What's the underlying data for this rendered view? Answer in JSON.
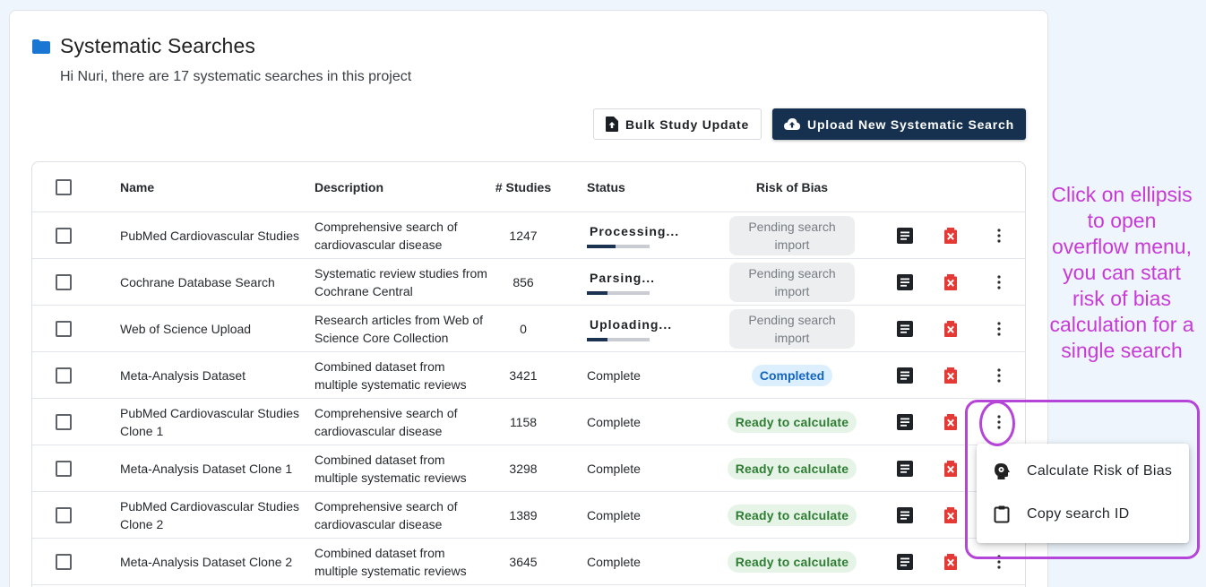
{
  "header": {
    "title": "Systematic Searches",
    "subtitle": "Hi Nuri, there are 17 systematic searches in this project",
    "icon": "folder-icon",
    "icon_color": "#1976d2"
  },
  "toolbar": {
    "bulk_update_label": "Bulk Study Update",
    "upload_label": "Upload New Systematic Search"
  },
  "table": {
    "columns": {
      "name": "Name",
      "description": "Description",
      "studies": "# Studies",
      "status": "Status",
      "risk_of_bias": "Risk of Bias"
    },
    "rows": [
      {
        "name": "PubMed Cardiovascular Studies",
        "description": "Comprehensive search of cardiovascular disease",
        "studies": "1247",
        "status": "Processing...",
        "status_type": "progress",
        "progress": 0.45,
        "rob": "Pending search import",
        "rob_type": "pending"
      },
      {
        "name": "Cochrane Database Search",
        "description": "Systematic review studies from Cochrane Central",
        "studies": "856",
        "status": "Parsing...",
        "status_type": "progress",
        "progress": 0.33,
        "rob": "Pending search import",
        "rob_type": "pending"
      },
      {
        "name": "Web of Science Upload",
        "description": "Research articles from Web of Science Core Collection",
        "studies": "0",
        "status": "Uploading...",
        "status_type": "progress",
        "progress": 0.33,
        "rob": "Pending search import",
        "rob_type": "pending"
      },
      {
        "name": "Meta-Analysis Dataset",
        "description": "Combined dataset from multiple systematic reviews",
        "studies": "3421",
        "status": "Complete",
        "status_type": "text",
        "rob": "Completed",
        "rob_type": "completed"
      },
      {
        "name": "PubMed Cardiovascular Studies Clone 1",
        "description": "Comprehensive search of cardiovascular disease",
        "studies": "1158",
        "status": "Complete",
        "status_type": "text",
        "rob": "Ready to calculate",
        "rob_type": "ready"
      },
      {
        "name": "Meta-Analysis Dataset Clone 1",
        "description": "Combined dataset from multiple systematic reviews",
        "studies": "3298",
        "status": "Complete",
        "status_type": "text",
        "rob": "Ready to calculate",
        "rob_type": "ready"
      },
      {
        "name": "PubMed Cardiovascular Studies Clone 2",
        "description": "Comprehensive search of cardiovascular disease",
        "studies": "1389",
        "status": "Complete",
        "status_type": "text",
        "rob": "Ready to calculate",
        "rob_type": "ready"
      },
      {
        "name": "Meta-Analysis Dataset Clone 2",
        "description": "Combined dataset from multiple systematic reviews",
        "studies": "3645",
        "status": "Complete",
        "status_type": "text",
        "rob": "Ready to calculate",
        "rob_type": "ready"
      }
    ]
  },
  "overflow_menu": {
    "items": [
      {
        "label": "Calculate Risk of Bias",
        "icon": "brain-gear-icon"
      },
      {
        "label": "Copy search ID",
        "icon": "clipboard-icon"
      }
    ]
  },
  "annotation": {
    "text": "Click on ellipsis to open overflow menu, you can start risk of bias calculation for a single search",
    "color": "#c83ad8"
  },
  "colors": {
    "primary_button": "#16314f",
    "delete_icon": "#e53935",
    "ready_badge": "#2e7d32",
    "completed_badge": "#1565c0"
  }
}
